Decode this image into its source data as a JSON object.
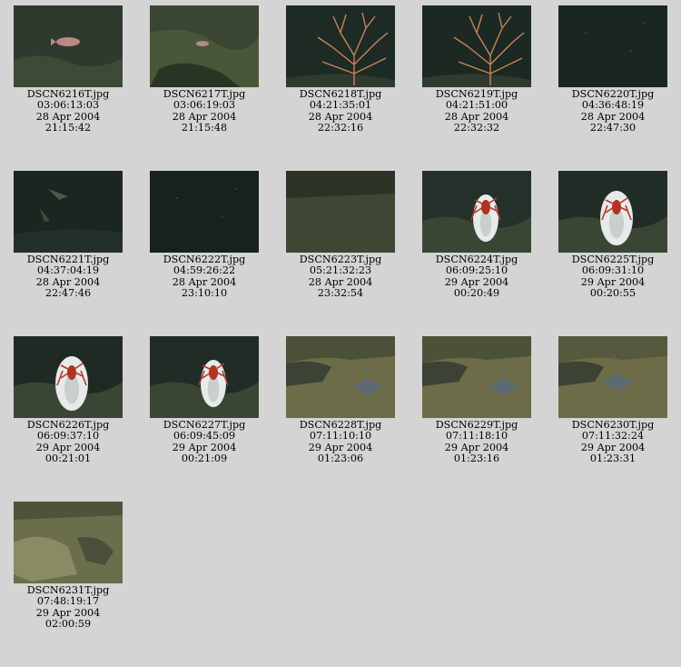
{
  "gallery": {
    "items": [
      {
        "file": "DSCN6216T.jpg",
        "elapsed": "03:06:13:03",
        "date": "28 Apr 2004",
        "time": "21:15:42",
        "scene": "fish-rock",
        "bg": "#2f3a2e"
      },
      {
        "file": "DSCN6217T.jpg",
        "elapsed": "03:06:19:03",
        "date": "28 Apr 2004",
        "time": "21:15:48",
        "scene": "rock-small-fish",
        "bg": "#3a4632"
      },
      {
        "file": "DSCN6218T.jpg",
        "elapsed": "04:21:35:01",
        "date": "28 Apr 2004",
        "time": "22:32:16",
        "scene": "coral",
        "bg": "#1e2a24"
      },
      {
        "file": "DSCN6219T.jpg",
        "elapsed": "04:21:51:00",
        "date": "28 Apr 2004",
        "time": "22:32:32",
        "scene": "coral",
        "bg": "#1c2822"
      },
      {
        "file": "DSCN6220T.jpg",
        "elapsed": "04:36:48:19",
        "date": "28 Apr 2004",
        "time": "22:47:30",
        "scene": "dark",
        "bg": "#1a2622"
      },
      {
        "file": "DSCN6221T.jpg",
        "elapsed": "04:37:04:19",
        "date": "28 Apr 2004",
        "time": "22:47:46",
        "scene": "dark-fish",
        "bg": "#1b2620"
      },
      {
        "file": "DSCN6222T.jpg",
        "elapsed": "04:59:26:22",
        "date": "28 Apr 2004",
        "time": "23:10:10",
        "scene": "dark",
        "bg": "#172220"
      },
      {
        "file": "DSCN6223T.jpg",
        "elapsed": "05:21:32:23",
        "date": "28 Apr 2004",
        "time": "23:32:54",
        "scene": "sand-dark",
        "bg": "#2c3326"
      },
      {
        "file": "DSCN6224T.jpg",
        "elapsed": "06:09:25:10",
        "date": "29 Apr 2004",
        "time": "00:20:49",
        "scene": "crab-trap",
        "bg": "#26302a"
      },
      {
        "file": "DSCN6225T.jpg",
        "elapsed": "06:09:31:10",
        "date": "29 Apr 2004",
        "time": "00:20:55",
        "scene": "crab-trap-big",
        "bg": "#222c26"
      },
      {
        "file": "DSCN6226T.jpg",
        "elapsed": "06:09:37:10",
        "date": "29 Apr 2004",
        "time": "00:21:01",
        "scene": "crab-trap-big",
        "bg": "#202a24"
      },
      {
        "file": "DSCN6227T.jpg",
        "elapsed": "06:09:45:09",
        "date": "29 Apr 2004",
        "time": "00:21:09",
        "scene": "crab-trap",
        "bg": "#222c26"
      },
      {
        "file": "DSCN6228T.jpg",
        "elapsed": "07:11:10:10",
        "date": "29 Apr 2004",
        "time": "01:23:06",
        "scene": "ray",
        "bg": "#4a5138"
      },
      {
        "file": "DSCN6229T.jpg",
        "elapsed": "07:11:18:10",
        "date": "29 Apr 2004",
        "time": "01:23:16",
        "scene": "ray",
        "bg": "#4c5238"
      },
      {
        "file": "DSCN6230T.jpg",
        "elapsed": "07:11:32:24",
        "date": "29 Apr 2004",
        "time": "01:23:31",
        "scene": "ray-big",
        "bg": "#565a3c"
      },
      {
        "file": "DSCN6231T.jpg",
        "elapsed": "07:48:19:17",
        "date": "29 Apr 2004",
        "time": "02:00:59",
        "scene": "rock-sand",
        "bg": "#4e5438"
      }
    ]
  }
}
